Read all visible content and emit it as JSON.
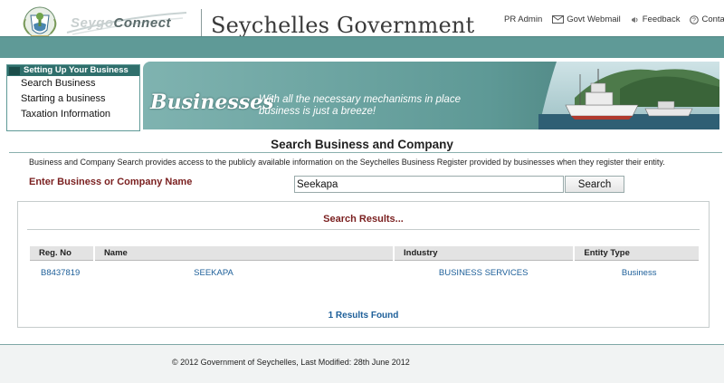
{
  "header": {
    "logo_text_a": "Seygo",
    "logo_text_b": "onnect",
    "site_title": "Seychelles Government",
    "top_links": {
      "pr_admin": "PR Admin",
      "webmail": "Govt Webmail",
      "feedback": "Feedback",
      "contact": "Contact Us"
    },
    "icons": {
      "webmail": "envelope-icon",
      "feedback": "megaphone-icon",
      "contact": "question-circle-icon"
    }
  },
  "sidebar": {
    "heading": "Setting Up Your Business",
    "items": [
      {
        "label": "Search Business"
      },
      {
        "label": "Starting a business"
      },
      {
        "label": "Taxation Information"
      }
    ]
  },
  "banner": {
    "word": "Businesses",
    "tagline_line1": "With all the necessary mechanisms in place",
    "tagline_line2": "business is just a breeze!"
  },
  "search": {
    "heading": "Search Business and Company",
    "intro": "Business and Company Search provides access to the publicly available information on the Seychelles Business Register provided by businesses when they register their entity.",
    "label": "Enter Business or Company Name",
    "value": "Seekapa",
    "button_label": "Search"
  },
  "results": {
    "title": "Search Results...",
    "columns": [
      "Reg. No",
      "Name",
      "Industry",
      "Entity Type"
    ],
    "rows": [
      {
        "reg_no": "B8437819",
        "name": "SEEKAPA",
        "industry": "BUSINESS SERVICES",
        "entity_type": "Business"
      }
    ],
    "count_text": "1 Results Found"
  },
  "footer": {
    "text": "© 2012 Government of Seychelles, Last Modified: 28th June 2012"
  },
  "colors": {
    "teal": "#5f9a97",
    "dark_teal": "#2f6f6c",
    "maroon": "#7a1f1f",
    "link_blue": "#1d5f99"
  }
}
